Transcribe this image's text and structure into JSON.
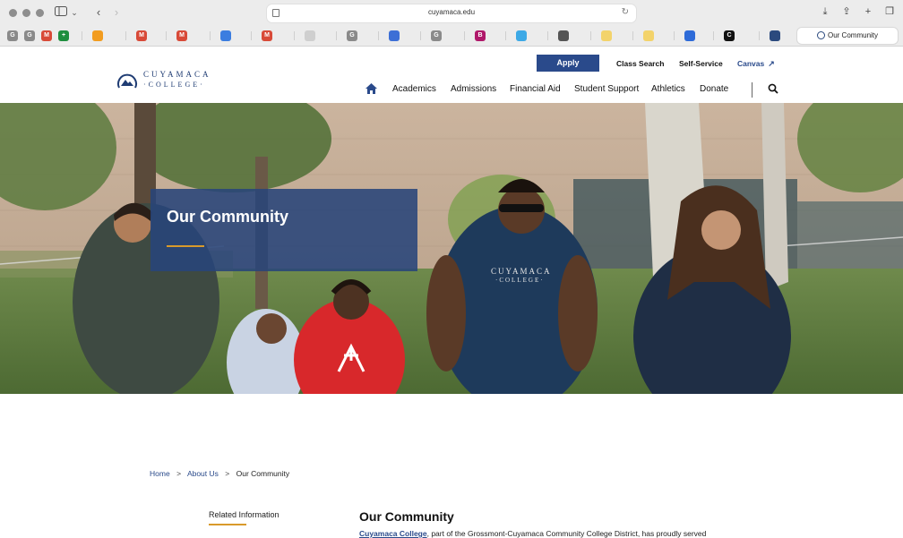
{
  "browser": {
    "url": "cuyamaca.edu",
    "active_tab_label": "Our Community",
    "tabs": [
      {
        "icon": "google-icon",
        "letter": "G",
        "color": "#8a8a8a"
      },
      {
        "icon": "google-icon",
        "letter": "G",
        "color": "#8a8a8a"
      },
      {
        "icon": "gmail-icon",
        "letter": "M",
        "color": "#d84a38"
      },
      {
        "icon": "sheets-icon",
        "letter": "+",
        "color": "#1e8e3e"
      },
      {
        "icon": "orange-icon",
        "letter": "",
        "color": "#f29c1f"
      },
      {
        "icon": "gmail-icon",
        "letter": "M",
        "color": "#d84a38"
      },
      {
        "icon": "gmail-icon",
        "letter": "M",
        "color": "#d84a38"
      },
      {
        "icon": "calendar-icon",
        "letter": "",
        "color": "#3b7de0"
      },
      {
        "icon": "gmail-icon",
        "letter": "M",
        "color": "#d84a38"
      },
      {
        "icon": "blank-page-icon",
        "letter": "",
        "color": "#cfcfcf"
      },
      {
        "icon": "google-icon",
        "letter": "G",
        "color": "#8a8a8a"
      },
      {
        "icon": "people-icon",
        "letter": "",
        "color": "#3d6fd6"
      },
      {
        "icon": "google-icon",
        "letter": "G",
        "color": "#8a8a8a"
      },
      {
        "icon": "b-icon",
        "letter": "B",
        "color": "#b0186a"
      },
      {
        "icon": "grid-icon",
        "letter": "",
        "color": "#3da9e6"
      },
      {
        "icon": "globe-icon",
        "letter": "",
        "color": "#555555"
      },
      {
        "icon": "note-icon",
        "letter": "",
        "color": "#f3d36b"
      },
      {
        "icon": "note-icon",
        "letter": "",
        "color": "#f3d36b"
      },
      {
        "icon": "refresh-app-icon",
        "letter": "",
        "color": "#2e6bd8"
      },
      {
        "icon": "c-icon",
        "letter": "C",
        "color": "#111111"
      },
      {
        "icon": "cuyamaca-icon",
        "letter": "",
        "color": "#2b4a7e"
      }
    ]
  },
  "logo": {
    "name": "CUYAMACA",
    "sub": "·COLLEGE·"
  },
  "utility_nav": {
    "apply": "Apply",
    "class_search": "Class Search",
    "self_service": "Self-Service",
    "canvas": "Canvas"
  },
  "main_nav": {
    "items": [
      "Academics",
      "Admissions",
      "Financial Aid",
      "Student Support",
      "Athletics",
      "Donate"
    ]
  },
  "hero": {
    "title": "Our Community",
    "shirt_text": "CUYAMACA",
    "shirt_sub": "·COLLEGE·"
  },
  "breadcrumb": {
    "home": "Home",
    "about": "About Us",
    "current": "Our Community",
    "separator": ">"
  },
  "sidebar": {
    "heading": "Related Information"
  },
  "content": {
    "title": "Our Community",
    "link_text": "Cuyamaca College",
    "text_after_link": ", part of the Grossmont-Cuyamaca Community College District, has proudly served"
  },
  "colors": {
    "brand_blue": "#2a4a8b",
    "accent_gold": "#d99a2b"
  }
}
